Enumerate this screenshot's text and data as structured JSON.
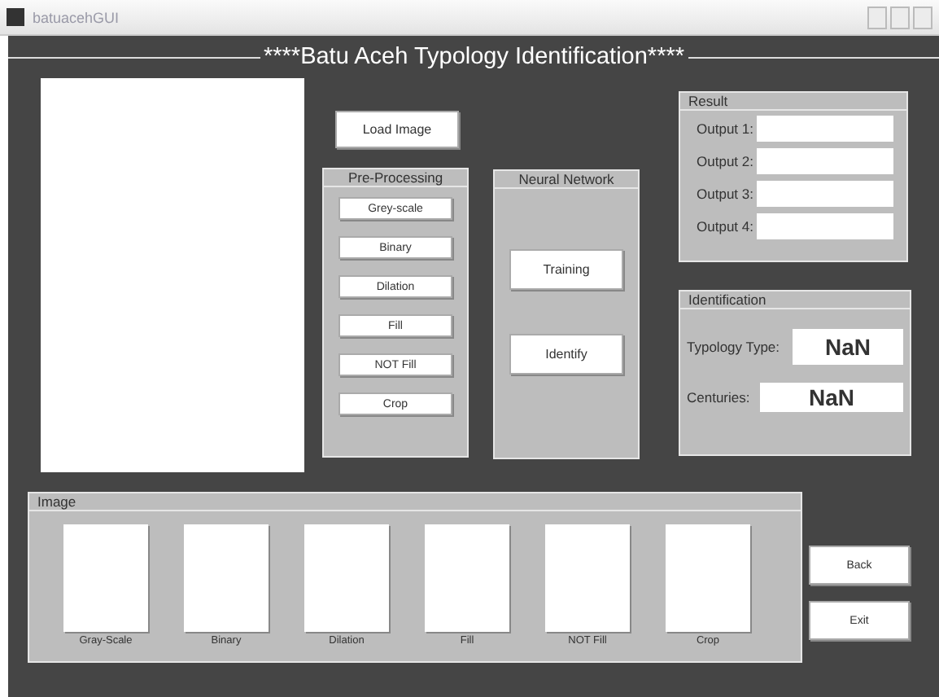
{
  "window": {
    "title": "batuacehGUI"
  },
  "heading": "****Batu Aceh Typology Identification****",
  "load_button": "Load Image",
  "preprocessing": {
    "title": "Pre-Processing",
    "buttons": [
      "Grey-scale",
      "Binary",
      "Dilation",
      "Fill",
      "NOT Fill",
      "Crop"
    ]
  },
  "neural_network": {
    "title": "Neural Network",
    "buttons": [
      "Training",
      "Identify"
    ]
  },
  "result": {
    "title": "Result",
    "outputs": [
      {
        "label": "Output 1:"
      },
      {
        "label": "Output 2:"
      },
      {
        "label": "Output 3:"
      },
      {
        "label": "Output 4:"
      }
    ]
  },
  "identification": {
    "title": "Identification",
    "fields": [
      {
        "label": "Typology Type:",
        "value": "NaN"
      },
      {
        "label": "Centuries:",
        "value": "NaN"
      }
    ]
  },
  "image_panel": {
    "title": "Image",
    "images": [
      "Gray-Scale",
      "Binary",
      "Dilation",
      "Fill",
      "NOT Fill",
      "Crop"
    ]
  },
  "side_buttons": [
    "Back",
    "Exit"
  ]
}
